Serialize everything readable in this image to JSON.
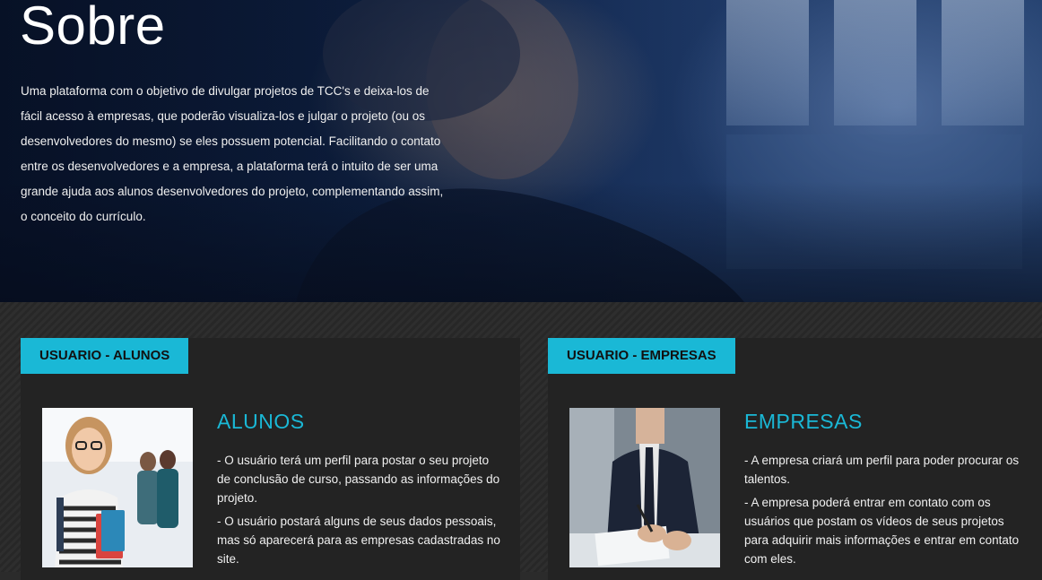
{
  "hero": {
    "title": "Sobre",
    "text": "Uma plataforma com o objetivo de divulgar projetos de TCC's e deixa-los de fácil acesso à empresas, que poderão visualiza-los e julgar o projeto (ou os desenvolvedores do mesmo) se eles possuem potencial. Facilitando o contato entre os desenvolvedores e a empresa, a plataforma terá o intuito de ser uma grande ajuda aos alunos desenvolvedores do projeto, complementando assim, o conceito do currículo."
  },
  "cards": [
    {
      "tab": "USUARIO - ALUNOS",
      "heading": "ALUNOS",
      "items": [
        "- O usuário terá um perfil para postar o seu projeto de conclusão de curso, passando as informações do projeto.",
        "- O usuário postará alguns de seus dados pessoais, mas só aparecerá para as empresas cadastradas no site."
      ]
    },
    {
      "tab": "USUARIO - EMPRESAS",
      "heading": "EMPRESAS",
      "items": [
        "- A empresa criará um perfil para poder procurar os talentos.",
        "- A empresa poderá entrar em contato com os usuários que postam os vídeos de seus projetos para adquirir mais informações e entrar em contato com eles."
      ]
    }
  ],
  "colors": {
    "accent": "#1ab8d6",
    "card_bg": "#232323",
    "hero_bg": "#0f2448"
  }
}
